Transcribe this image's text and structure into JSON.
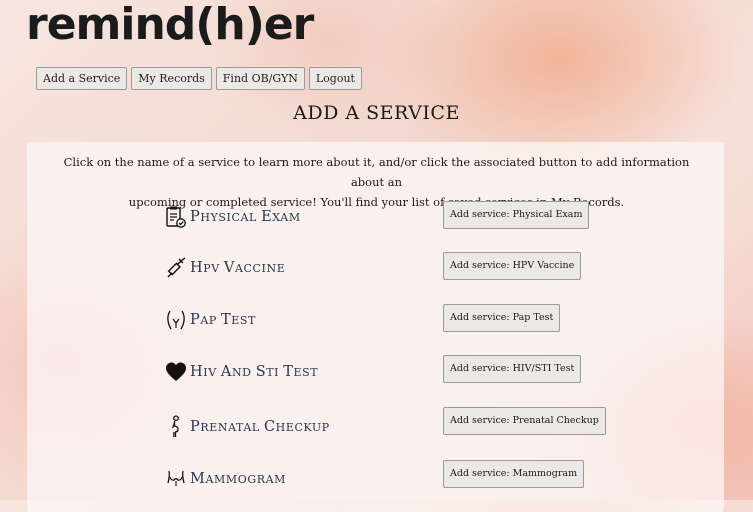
{
  "brand": {
    "logo": "remind(h)er"
  },
  "nav": {
    "items": [
      "Add a Service",
      "My Records",
      "Find OB/GYN",
      "Logout"
    ]
  },
  "page": {
    "title": "ADD A SERVICE",
    "intro_line1": "Click on the name of a service to learn more about it, and/or click the associated button to add information about an",
    "intro_line2": "upcoming or completed service! You'll find your list of saved services in My Records."
  },
  "services": [
    {
      "name": "Physical Exam",
      "icon": "clipboard-check-icon",
      "button": "Add service: Physical Exam"
    },
    {
      "name": "HPV Vaccine",
      "icon": "syringe-icon",
      "button": "Add service: HPV Vaccine"
    },
    {
      "name": "Pap Test",
      "icon": "pelvis-icon",
      "button": "Add service: Pap Test"
    },
    {
      "name": "HIV and STI Test",
      "icon": "heart-icon",
      "button": "Add service: HIV/STI Test"
    },
    {
      "name": "Prenatal Checkup",
      "icon": "pregnant-woman-icon",
      "button": "Add service: Prenatal Checkup"
    },
    {
      "name": "Mammogram",
      "icon": "torso-icon",
      "button": "Add service: Mammogram"
    }
  ]
}
